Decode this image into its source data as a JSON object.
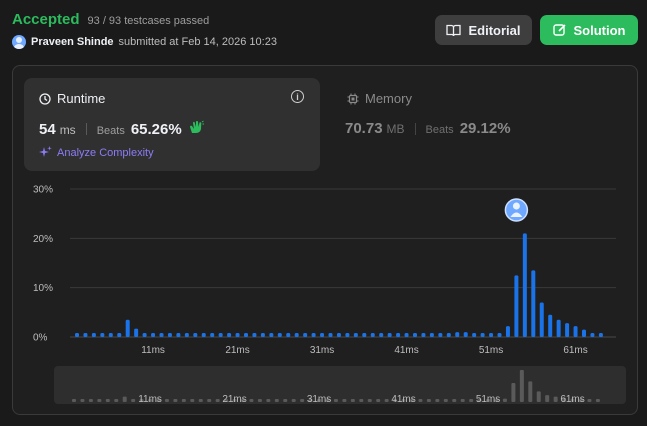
{
  "status": {
    "accepted": "Accepted",
    "passed": "93 / 93 testcases passed"
  },
  "submission": {
    "user": "Praveen Shinde",
    "text": "submitted at Feb 14, 2026 10:23"
  },
  "buttons": {
    "editorial": "Editorial",
    "solution": "Solution"
  },
  "runtime": {
    "title": "Runtime",
    "value": "54",
    "unit": "ms",
    "beats_label": "Beats",
    "beats": "65.26%",
    "analyze": "Analyze Complexity"
  },
  "memory": {
    "title": "Memory",
    "value": "70.73",
    "unit": "MB",
    "beats_label": "Beats",
    "beats": "29.12%"
  },
  "colors": {
    "accent_green": "#2cbb5d",
    "bar_blue": "#1a73e8",
    "analyze_purple": "#8b7cf6"
  },
  "chart_data": {
    "type": "bar",
    "ylabel_ticks": [
      "30%",
      "20%",
      "10%",
      "0%"
    ],
    "ylim": [
      0,
      30
    ],
    "x_tick_labels": [
      "11ms",
      "21ms",
      "31ms",
      "41ms",
      "51ms",
      "61ms"
    ],
    "x_ticks": [
      11,
      21,
      31,
      41,
      51,
      61
    ],
    "series": [
      {
        "x": [
          2,
          3,
          4,
          5,
          6,
          7,
          8,
          9,
          10,
          11,
          12,
          13,
          14,
          15,
          16,
          17,
          18,
          19,
          20,
          21,
          22,
          23,
          24,
          25,
          26,
          27,
          28,
          29,
          30,
          31,
          32,
          33,
          34,
          35,
          36,
          37,
          38,
          39,
          40,
          41,
          42,
          43,
          44,
          45,
          46,
          47,
          48,
          49,
          50,
          51,
          52,
          53,
          54,
          55,
          56,
          57,
          58,
          59,
          60,
          61,
          62,
          63,
          64
        ],
        "values": [
          0.8,
          0.8,
          0.8,
          0.8,
          0.8,
          0.8,
          3.5,
          1.7,
          0.8,
          0.8,
          0.8,
          0.8,
          0.8,
          0.8,
          0.8,
          0.8,
          0.8,
          0.8,
          0.8,
          0.8,
          0.8,
          0.8,
          0.8,
          0.8,
          0.8,
          0.8,
          0.8,
          0.8,
          0.8,
          0.8,
          0.8,
          0.8,
          0.8,
          0.8,
          0.8,
          0.8,
          0.8,
          0.8,
          0.8,
          0.8,
          0.8,
          0.8,
          0.8,
          0.8,
          0.8,
          1.0,
          1.0,
          0.8,
          0.8,
          0.8,
          0.8,
          2.2,
          12.5,
          21.0,
          13.5,
          7.0,
          4.5,
          3.5,
          2.8,
          2.2,
          1.5,
          0.8,
          0.8
        ]
      }
    ],
    "highlight_x": 54
  }
}
